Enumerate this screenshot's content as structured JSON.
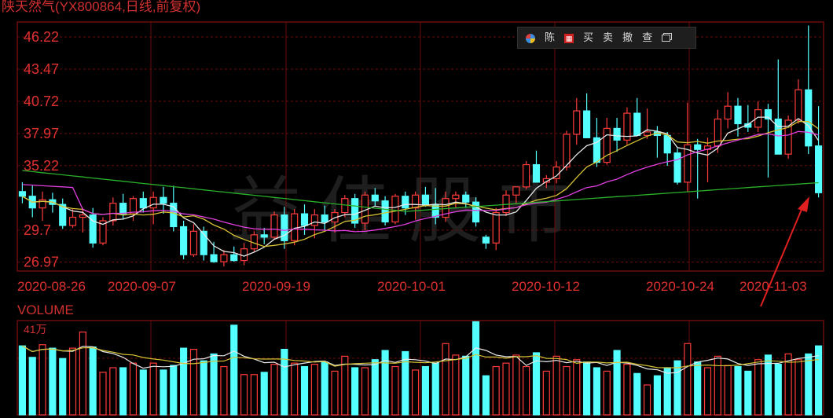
{
  "header": {
    "title": "陕天然气(YX800864,日线,前复权)"
  },
  "toolbar": {
    "items": [
      {
        "label": "陈"
      },
      {
        "label": "买"
      },
      {
        "label": "卖"
      },
      {
        "label": "撤"
      },
      {
        "label": "查"
      }
    ]
  },
  "volume_panel": {
    "label": "VOLUME",
    "max_label": "41万"
  },
  "watermark": "益佳股市",
  "colors": {
    "up": "#ff3b3b",
    "down": "#54ffff",
    "grid": "#6b0d0d",
    "ma5": "#e8e8e8",
    "ma10": "#d6c234",
    "ma20": "#e040e0",
    "ma60": "#2ab02a",
    "arrow": "#e02020",
    "axis_text": "#e03030"
  },
  "chart_data": {
    "type": "candlestick",
    "price_ticks": [
      "46.22",
      "43.47",
      "40.72",
      "37.97",
      "35.22",
      "29.7",
      "26.97"
    ],
    "date_labels": [
      "2020-08-26",
      "2020-09-07",
      "2020-09-19",
      "2020-10-01",
      "2020-10-12",
      "2020-10-24",
      "2020-11-03"
    ],
    "ylim": [
      26.2,
      47.5
    ],
    "volume_ylim": [
      0,
      410000
    ],
    "ohlc": [
      [
        33.0,
        33.8,
        32.0,
        32.6
      ],
      [
        32.6,
        33.5,
        30.8,
        31.6
      ],
      [
        31.6,
        33.0,
        30.5,
        32.3
      ],
      [
        32.3,
        32.9,
        31.2,
        31.9
      ],
      [
        31.9,
        32.4,
        29.8,
        30.1
      ],
      [
        30.1,
        31.5,
        29.9,
        30.8
      ],
      [
        30.8,
        31.6,
        29.5,
        31.0
      ],
      [
        31.0,
        31.6,
        28.2,
        28.6
      ],
      [
        28.6,
        30.8,
        28.4,
        30.5
      ],
      [
        30.5,
        32.5,
        30.1,
        32.0
      ],
      [
        32.0,
        32.8,
        30.6,
        31.1
      ],
      [
        31.1,
        32.6,
        30.5,
        32.4
      ],
      [
        32.4,
        33.0,
        31.2,
        31.6
      ],
      [
        31.6,
        33.0,
        30.2,
        32.5
      ],
      [
        32.5,
        33.4,
        31.1,
        32.0
      ],
      [
        32.0,
        33.5,
        29.6,
        30.0
      ],
      [
        30.0,
        30.5,
        27.2,
        27.6
      ],
      [
        27.6,
        30.2,
        27.4,
        29.6
      ],
      [
        29.6,
        30.0,
        27.1,
        27.6
      ],
      [
        27.6,
        28.7,
        26.9,
        27.0
      ],
      [
        27.0,
        28.0,
        26.6,
        27.6
      ],
      [
        27.6,
        28.3,
        27.0,
        27.1
      ],
      [
        27.1,
        28.6,
        26.7,
        28.1
      ],
      [
        28.1,
        29.6,
        27.8,
        29.3
      ],
      [
        29.3,
        29.9,
        28.5,
        29.1
      ],
      [
        29.1,
        31.3,
        28.9,
        31.0
      ],
      [
        31.0,
        31.7,
        28.1,
        28.8
      ],
      [
        28.8,
        31.5,
        28.4,
        31.1
      ],
      [
        31.1,
        31.9,
        29.3,
        30.1
      ],
      [
        30.1,
        31.5,
        29.0,
        31.0
      ],
      [
        31.0,
        31.8,
        29.7,
        30.4
      ],
      [
        30.4,
        31.5,
        29.5,
        31.2
      ],
      [
        31.2,
        32.7,
        30.8,
        32.4
      ],
      [
        32.4,
        32.8,
        29.9,
        30.3
      ],
      [
        30.3,
        33.0,
        29.7,
        32.7
      ],
      [
        32.7,
        33.3,
        31.7,
        32.2
      ],
      [
        32.2,
        32.6,
        30.1,
        30.4
      ],
      [
        30.4,
        32.8,
        30.2,
        32.6
      ],
      [
        32.6,
        33.0,
        31.0,
        31.6
      ],
      [
        31.6,
        33.0,
        30.6,
        32.7
      ],
      [
        32.7,
        33.4,
        31.7,
        31.9
      ],
      [
        31.9,
        33.3,
        30.2,
        30.8
      ],
      [
        30.8,
        33.0,
        30.4,
        32.4
      ],
      [
        32.4,
        33.0,
        31.6,
        32.7
      ],
      [
        32.7,
        33.0,
        31.6,
        32.1
      ],
      [
        32.1,
        32.5,
        30.0,
        30.4
      ],
      [
        29.1,
        29.3,
        28.1,
        28.6
      ],
      [
        28.6,
        31.6,
        28.0,
        31.2
      ],
      [
        31.2,
        33.1,
        30.9,
        32.7
      ],
      [
        32.7,
        33.3,
        31.9,
        33.4
      ],
      [
        33.4,
        35.6,
        33.2,
        35.3
      ],
      [
        35.3,
        36.5,
        34.0,
        33.8
      ],
      [
        33.8,
        34.4,
        33.3,
        34.1
      ],
      [
        34.1,
        35.6,
        33.7,
        35.1
      ],
      [
        35.1,
        38.2,
        34.8,
        37.9
      ],
      [
        37.9,
        41.0,
        37.0,
        39.9
      ],
      [
        39.9,
        41.4,
        37.6,
        37.6
      ],
      [
        37.6,
        39.3,
        35.1,
        35.5
      ],
      [
        35.5,
        39.3,
        35.3,
        38.4
      ],
      [
        38.4,
        39.3,
        36.4,
        37.4
      ],
      [
        37.4,
        40.2,
        37.0,
        39.7
      ],
      [
        39.7,
        41.0,
        38.4,
        37.8
      ],
      [
        37.8,
        40.1,
        37.5,
        38.1
      ],
      [
        38.1,
        38.6,
        35.9,
        37.8
      ],
      [
        37.8,
        38.1,
        35.2,
        36.3
      ],
      [
        36.3,
        36.7,
        33.6,
        33.8
      ],
      [
        33.8,
        40.6,
        33.0,
        37.0
      ],
      [
        37.0,
        37.5,
        32.4,
        36.6
      ],
      [
        36.6,
        37.6,
        33.8,
        36.9
      ],
      [
        36.9,
        40.0,
        36.3,
        39.2
      ],
      [
        39.2,
        41.5,
        38.4,
        40.3
      ],
      [
        40.3,
        41.0,
        37.7,
        38.8
      ],
      [
        38.8,
        40.4,
        38.1,
        38.5
      ],
      [
        38.5,
        40.7,
        38.1,
        40.0
      ],
      [
        40.0,
        40.5,
        34.2,
        39.2
      ],
      [
        39.2,
        44.3,
        38.6,
        36.2
      ],
      [
        36.2,
        39.5,
        35.8,
        39.1
      ],
      [
        39.1,
        42.6,
        38.8,
        41.7
      ],
      [
        41.7,
        47.2,
        36.2,
        36.9
      ],
      [
        36.9,
        40.3,
        32.5,
        32.9
      ]
    ],
    "volume": [
      300000,
      250000,
      305000,
      290000,
      245000,
      290000,
      360000,
      295000,
      185000,
      205000,
      205000,
      225000,
      195000,
      225000,
      195000,
      215000,
      290000,
      285000,
      235000,
      265000,
      210000,
      390000,
      175000,
      175000,
      185000,
      220000,
      285000,
      225000,
      210000,
      220000,
      230000,
      190000,
      255000,
      205000,
      205000,
      240000,
      280000,
      210000,
      275000,
      195000,
      210000,
      225000,
      310000,
      260000,
      255000,
      405000,
      170000,
      210000,
      225000,
      260000,
      210000,
      270000,
      190000,
      255000,
      210000,
      240000,
      230000,
      205000,
      190000,
      280000,
      220000,
      180000,
      130000,
      170000,
      205000,
      235000,
      310000,
      230000,
      205000,
      255000,
      215000,
      210000,
      190000,
      240000,
      260000,
      220000,
      265000,
      240000,
      265000,
      300000
    ]
  }
}
